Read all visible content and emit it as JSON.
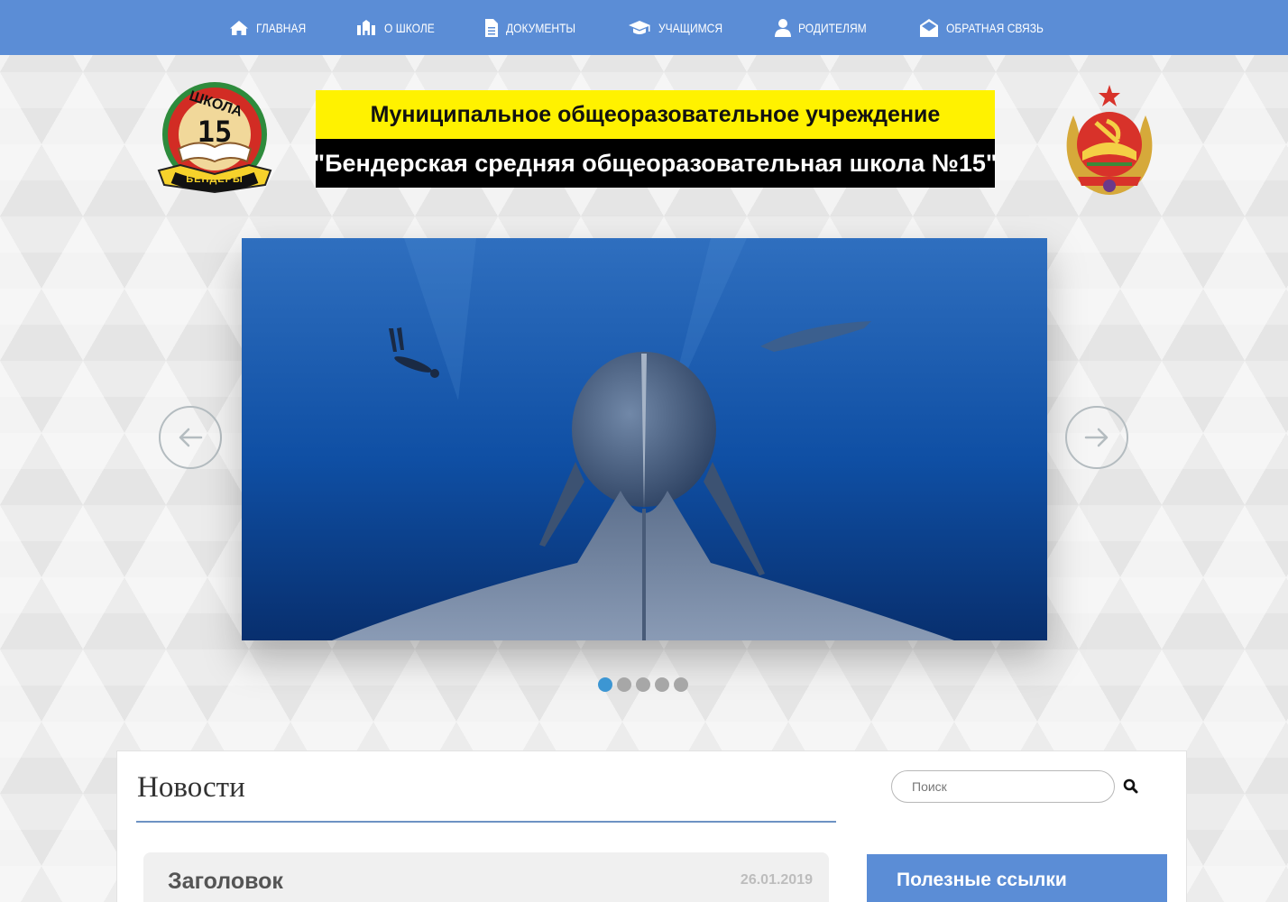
{
  "nav": {
    "items": [
      {
        "label": "Главная",
        "icon": "home-icon"
      },
      {
        "label": "О школе",
        "icon": "school-icon"
      },
      {
        "label": "Документы",
        "icon": "document-icon"
      },
      {
        "label": "Учащимся",
        "icon": "graduation-cap-icon"
      },
      {
        "label": "Родителям",
        "icon": "user-icon"
      },
      {
        "label": "Обратная связь",
        "icon": "envelope-open-icon"
      }
    ]
  },
  "header": {
    "logo": {
      "text_top": "ШКОЛА",
      "number": "15",
      "text_bottom": "БЕНДЕРЫ"
    },
    "banner_line1": "Муниципальное общеоразовательное учреждение",
    "banner_line2": "\"Бендерская средняя общеоразовательная школа №15\"",
    "emblem": "coat-of-arms-icon"
  },
  "slider": {
    "image": "humpback-whale-underwater-photo",
    "slide_count": 5,
    "active_index": 0
  },
  "main": {
    "news_title": "Новости",
    "search": {
      "placeholder": "Поиск"
    },
    "post": {
      "heading": "Заголовок",
      "date": "26.01.2019"
    },
    "sidebar_title": "Полезные ссылки"
  },
  "colors": {
    "nav_bg": "#5b8dd6",
    "banner_yellow": "#fff200",
    "dot_active": "#3c96d3"
  }
}
